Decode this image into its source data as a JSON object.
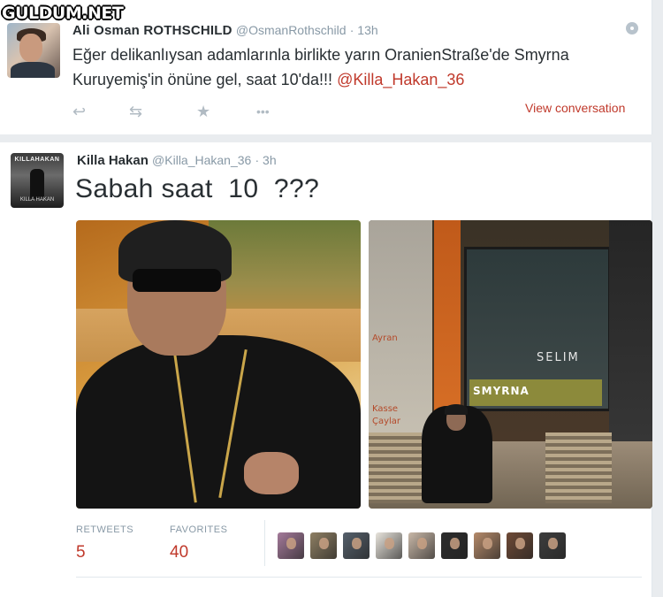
{
  "watermark": "GULDUM.NET",
  "tweet1": {
    "name": "Ali Osman ROTHSCHILD",
    "handle": "@OsmanRothschild",
    "time": "· 13h",
    "text_main": "Eğer delikanlıysan adamlarınla birlikte yarın OranienStraße'de Smyrna Kuruyemiş'in önüne gel, saat 10'da!!! ",
    "mention": "@Killa_Hakan_36",
    "view_conversation": "View conversation",
    "actions": [
      "reply-icon",
      "retweet-icon",
      "favorite-icon",
      "more-icon"
    ]
  },
  "tweet2": {
    "name": "Killa Hakan",
    "handle": "@Killa_Hakan_36",
    "time": "· 3h",
    "text": "Sabah saat  10  ???",
    "avatar_text_top": "KILLAHAKAN",
    "avatar_text_bottom": "KILLA HAKAN",
    "photo2_texts": {
      "smyrna": "SMYRNA",
      "selim": "SELIM",
      "ayran": "Ayran",
      "kasse": "Kasse",
      "cay": "Çaylar"
    },
    "stats": {
      "retweets_label": "RETWEETS",
      "retweets_value": "5",
      "favorites_label": "FAVORITES",
      "favorites_value": "40"
    },
    "favoriters": [
      {
        "name": "favoriter-1",
        "color": "#a47a9a"
      },
      {
        "name": "favoriter-2",
        "color": "#8e7f63"
      },
      {
        "name": "favoriter-3",
        "color": "#55606b"
      },
      {
        "name": "favoriter-4",
        "color": "#e8e4dc"
      },
      {
        "name": "favoriter-5",
        "color": "#c9b8a8"
      },
      {
        "name": "favoriter-6",
        "color": "#2c2c2c"
      },
      {
        "name": "favoriter-7",
        "color": "#b58a6a"
      },
      {
        "name": "favoriter-8",
        "color": "#6e4a36"
      },
      {
        "name": "favoriter-9",
        "color": "#3d3d3d"
      }
    ]
  },
  "colors": {
    "accent": "#c0392b",
    "text": "#292f33",
    "muted": "#8899a6",
    "background": "#e9ecef"
  }
}
